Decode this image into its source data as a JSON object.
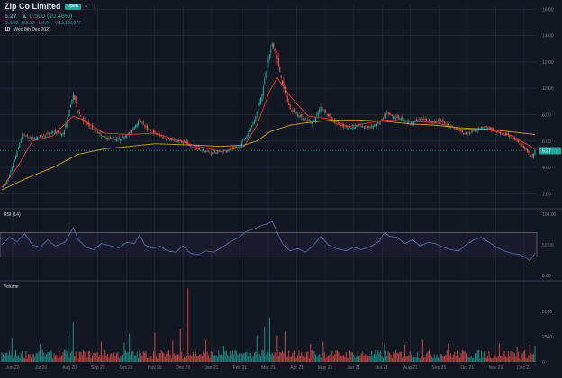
{
  "header": {
    "title": "Zip Co Limited",
    "badge": "Open",
    "price": "5.27",
    "change": "▲ 0.500 (10.48%)",
    "ohlc": {
      "o_label": "O:",
      "o": "4.90",
      "h_label": "H:",
      "h": "5.32",
      "l_label": "L:",
      "l": "4.94",
      "v_label": "V:",
      "v": "13,115,077"
    },
    "interval": "1D",
    "date": "Wed 8th Dec 2021"
  },
  "rsi": {
    "label": "RSI (14)",
    "upper": 70,
    "lower": 30
  },
  "volume_label": "Volume",
  "colors": {
    "background": "#131722",
    "up": "#26a69a",
    "down": "#ef5350",
    "ma_short": "#e53935",
    "ma_long": "#c9a227",
    "rsi_line": "#5b6fb5",
    "grid": "#2a2e39",
    "axis_text": "#787b86",
    "last_price_bg": "#26a69a"
  },
  "chart_data": [
    {
      "type": "candlestick",
      "title": "Zip Co Limited",
      "xlabel": "",
      "ylabel": "",
      "ylim": [
        1.0,
        16.3
      ],
      "ytick_labels": [
        "2.00",
        "4.00",
        "6.00",
        "8.00",
        "10.00",
        "12.00",
        "14.00",
        "16.00"
      ],
      "x_tick_labels": [
        "Jun 20",
        "Jul 20",
        "Aug 20",
        "Sep 20",
        "Oct 20",
        "Nov 20",
        "Dec 20",
        "Jan 21",
        "Feb 21",
        "Mar 21",
        "Apr 21",
        "May 21",
        "Jun 21",
        "Jul 21",
        "Aug 21",
        "Sep 21",
        "Oct 21",
        "Nov 21",
        "Dec 21"
      ],
      "last_price_label": "5.27",
      "close_anchors": [
        [
          0,
          2.5
        ],
        [
          4,
          2.9
        ],
        [
          10,
          4.6
        ],
        [
          16,
          6.5
        ],
        [
          24,
          6.2
        ],
        [
          32,
          6.4
        ],
        [
          40,
          6.7
        ],
        [
          48,
          6.5
        ],
        [
          56,
          9.5
        ],
        [
          60,
          8.2
        ],
        [
          64,
          7.5
        ],
        [
          72,
          6.9
        ],
        [
          80,
          6.3
        ],
        [
          86,
          6.2
        ],
        [
          92,
          6.1
        ],
        [
          100,
          6.6
        ],
        [
          108,
          7.6
        ],
        [
          114,
          6.9
        ],
        [
          120,
          6.6
        ],
        [
          128,
          6.2
        ],
        [
          136,
          6.0
        ],
        [
          144,
          5.9
        ],
        [
          150,
          5.5
        ],
        [
          156,
          5.3
        ],
        [
          164,
          5.1
        ],
        [
          172,
          5.2
        ],
        [
          178,
          5.3
        ],
        [
          186,
          5.6
        ],
        [
          192,
          6.4
        ],
        [
          198,
          7.6
        ],
        [
          204,
          9.6
        ],
        [
          208,
          11.8
        ],
        [
          212,
          13.4
        ],
        [
          216,
          12.2
        ],
        [
          220,
          10.3
        ],
        [
          226,
          8.4
        ],
        [
          232,
          8.0
        ],
        [
          238,
          7.6
        ],
        [
          244,
          7.4
        ],
        [
          250,
          8.6
        ],
        [
          256,
          7.9
        ],
        [
          262,
          7.3
        ],
        [
          268,
          7.1
        ],
        [
          274,
          7.0
        ],
        [
          280,
          7.2
        ],
        [
          288,
          7.0
        ],
        [
          296,
          7.4
        ],
        [
          302,
          8.1
        ],
        [
          308,
          7.8
        ],
        [
          314,
          7.7
        ],
        [
          320,
          7.3
        ],
        [
          328,
          7.7
        ],
        [
          336,
          7.5
        ],
        [
          344,
          7.5
        ],
        [
          350,
          7.2
        ],
        [
          358,
          6.8
        ],
        [
          364,
          6.5
        ],
        [
          372,
          6.9
        ],
        [
          378,
          7.1
        ],
        [
          386,
          6.8
        ],
        [
          392,
          6.5
        ],
        [
          398,
          6.4
        ],
        [
          404,
          6.0
        ],
        [
          410,
          5.4
        ],
        [
          416,
          4.8
        ],
        [
          418,
          5.27
        ]
      ],
      "moving_averages": [
        {
          "name": "",
          "color": "#e53935",
          "anchors": [
            [
              0,
              2.5
            ],
            [
              12,
              4.0
            ],
            [
              24,
              6.0
            ],
            [
              40,
              6.4
            ],
            [
              56,
              7.9
            ],
            [
              64,
              7.6
            ],
            [
              80,
              6.6
            ],
            [
              100,
              6.5
            ],
            [
              120,
              6.6
            ],
            [
              150,
              5.7
            ],
            [
              172,
              5.2
            ],
            [
              190,
              5.6
            ],
            [
              200,
              7.2
            ],
            [
              210,
              9.8
            ],
            [
              216,
              10.8
            ],
            [
              226,
              9.4
            ],
            [
              240,
              7.9
            ],
            [
              256,
              7.7
            ],
            [
              272,
              7.1
            ],
            [
              300,
              7.6
            ],
            [
              320,
              7.5
            ],
            [
              340,
              7.4
            ],
            [
              360,
              6.9
            ],
            [
              380,
              6.9
            ],
            [
              400,
              6.4
            ],
            [
              418,
              5.4
            ]
          ]
        },
        {
          "name": "",
          "color": "#c9a227",
          "anchors": [
            [
              0,
              2.3
            ],
            [
              20,
              3.2
            ],
            [
              40,
              4.0
            ],
            [
              60,
              5.0
            ],
            [
              80,
              5.4
            ],
            [
              100,
              5.6
            ],
            [
              120,
              5.8
            ],
            [
              150,
              5.7
            ],
            [
              172,
              5.6
            ],
            [
              190,
              5.7
            ],
            [
              200,
              6.0
            ],
            [
              210,
              6.7
            ],
            [
              226,
              7.2
            ],
            [
              240,
              7.4
            ],
            [
              260,
              7.6
            ],
            [
              280,
              7.6
            ],
            [
              300,
              7.5
            ],
            [
              320,
              7.3
            ],
            [
              340,
              7.2
            ],
            [
              360,
              7.0
            ],
            [
              380,
              6.9
            ],
            [
              400,
              6.7
            ],
            [
              418,
              6.5
            ]
          ]
        }
      ]
    },
    {
      "type": "line",
      "title": "RSI (14)",
      "ylim": [
        0,
        100
      ],
      "ytick_labels": [
        "100.00",
        "50.00",
        "0.00"
      ],
      "last_value": 36,
      "anchors": [
        [
          0,
          50
        ],
        [
          6,
          62
        ],
        [
          12,
          55
        ],
        [
          18,
          68
        ],
        [
          24,
          50
        ],
        [
          30,
          46
        ],
        [
          36,
          58
        ],
        [
          42,
          48
        ],
        [
          50,
          55
        ],
        [
          56,
          78
        ],
        [
          60,
          58
        ],
        [
          66,
          46
        ],
        [
          72,
          42
        ],
        [
          78,
          52
        ],
        [
          86,
          48
        ],
        [
          92,
          45
        ],
        [
          98,
          54
        ],
        [
          104,
          52
        ],
        [
          108,
          66
        ],
        [
          112,
          50
        ],
        [
          118,
          44
        ],
        [
          124,
          48
        ],
        [
          130,
          40
        ],
        [
          136,
          38
        ],
        [
          142,
          48
        ],
        [
          148,
          36
        ],
        [
          154,
          34
        ],
        [
          160,
          40
        ],
        [
          166,
          38
        ],
        [
          172,
          45
        ],
        [
          180,
          56
        ],
        [
          186,
          62
        ],
        [
          192,
          72
        ],
        [
          198,
          76
        ],
        [
          204,
          82
        ],
        [
          208,
          84
        ],
        [
          212,
          88
        ],
        [
          216,
          70
        ],
        [
          220,
          52
        ],
        [
          226,
          40
        ],
        [
          232,
          44
        ],
        [
          238,
          38
        ],
        [
          244,
          48
        ],
        [
          250,
          64
        ],
        [
          256,
          50
        ],
        [
          262,
          44
        ],
        [
          270,
          40
        ],
        [
          276,
          46
        ],
        [
          282,
          42
        ],
        [
          290,
          48
        ],
        [
          296,
          56
        ],
        [
          300,
          70
        ],
        [
          304,
          64
        ],
        [
          310,
          62
        ],
        [
          316,
          52
        ],
        [
          322,
          58
        ],
        [
          328,
          48
        ],
        [
          334,
          54
        ],
        [
          340,
          52
        ],
        [
          346,
          46
        ],
        [
          352,
          42
        ],
        [
          358,
          40
        ],
        [
          364,
          50
        ],
        [
          370,
          58
        ],
        [
          376,
          62
        ],
        [
          382,
          54
        ],
        [
          388,
          46
        ],
        [
          394,
          40
        ],
        [
          400,
          36
        ],
        [
          406,
          34
        ],
        [
          410,
          30
        ],
        [
          414,
          24
        ],
        [
          418,
          36
        ]
      ]
    },
    {
      "type": "bar",
      "title": "Volume",
      "ylim": [
        0,
        7500
      ],
      "ytick_labels": [
        "5000",
        "2500",
        "0"
      ],
      "spikes": [
        [
          8,
          2300
        ],
        [
          30,
          1800
        ],
        [
          52,
          2600
        ],
        [
          56,
          3900
        ],
        [
          78,
          2000
        ],
        [
          96,
          1900
        ],
        [
          100,
          2800
        ],
        [
          120,
          2900
        ],
        [
          134,
          2100
        ],
        [
          140,
          3300
        ],
        [
          146,
          7300
        ],
        [
          160,
          2200
        ],
        [
          174,
          1600
        ],
        [
          200,
          2600
        ],
        [
          206,
          3500
        ],
        [
          210,
          4400
        ],
        [
          216,
          2600
        ],
        [
          222,
          3000
        ],
        [
          242,
          1800
        ],
        [
          252,
          2000
        ],
        [
          300,
          1800
        ],
        [
          316,
          1700
        ],
        [
          330,
          2200
        ],
        [
          350,
          1800
        ],
        [
          390,
          1800
        ],
        [
          404,
          1500
        ],
        [
          414,
          1700
        ],
        [
          418,
          1600
        ]
      ]
    }
  ]
}
